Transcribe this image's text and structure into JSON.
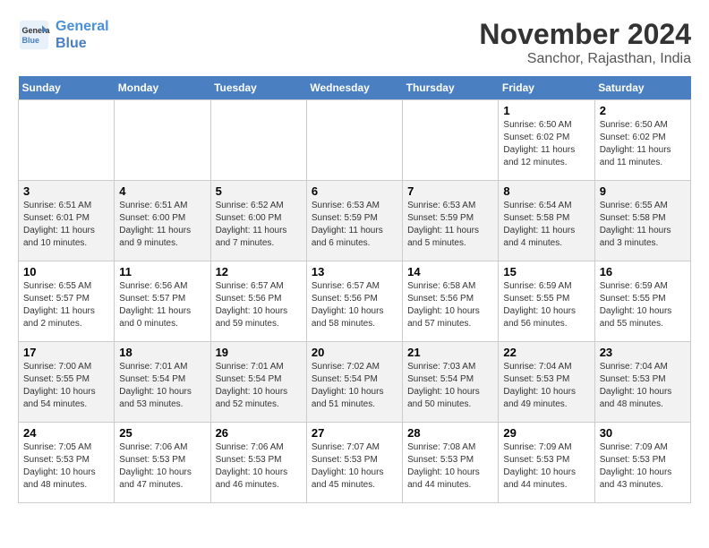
{
  "header": {
    "logo_line1": "General",
    "logo_line2": "Blue",
    "month": "November 2024",
    "location": "Sanchor, Rajasthan, India"
  },
  "weekdays": [
    "Sunday",
    "Monday",
    "Tuesday",
    "Wednesday",
    "Thursday",
    "Friday",
    "Saturday"
  ],
  "weeks": [
    [
      {
        "day": "",
        "info": ""
      },
      {
        "day": "",
        "info": ""
      },
      {
        "day": "",
        "info": ""
      },
      {
        "day": "",
        "info": ""
      },
      {
        "day": "",
        "info": ""
      },
      {
        "day": "1",
        "info": "Sunrise: 6:50 AM\nSunset: 6:02 PM\nDaylight: 11 hours and 12 minutes."
      },
      {
        "day": "2",
        "info": "Sunrise: 6:50 AM\nSunset: 6:02 PM\nDaylight: 11 hours and 11 minutes."
      }
    ],
    [
      {
        "day": "3",
        "info": "Sunrise: 6:51 AM\nSunset: 6:01 PM\nDaylight: 11 hours and 10 minutes."
      },
      {
        "day": "4",
        "info": "Sunrise: 6:51 AM\nSunset: 6:00 PM\nDaylight: 11 hours and 9 minutes."
      },
      {
        "day": "5",
        "info": "Sunrise: 6:52 AM\nSunset: 6:00 PM\nDaylight: 11 hours and 7 minutes."
      },
      {
        "day": "6",
        "info": "Sunrise: 6:53 AM\nSunset: 5:59 PM\nDaylight: 11 hours and 6 minutes."
      },
      {
        "day": "7",
        "info": "Sunrise: 6:53 AM\nSunset: 5:59 PM\nDaylight: 11 hours and 5 minutes."
      },
      {
        "day": "8",
        "info": "Sunrise: 6:54 AM\nSunset: 5:58 PM\nDaylight: 11 hours and 4 minutes."
      },
      {
        "day": "9",
        "info": "Sunrise: 6:55 AM\nSunset: 5:58 PM\nDaylight: 11 hours and 3 minutes."
      }
    ],
    [
      {
        "day": "10",
        "info": "Sunrise: 6:55 AM\nSunset: 5:57 PM\nDaylight: 11 hours and 2 minutes."
      },
      {
        "day": "11",
        "info": "Sunrise: 6:56 AM\nSunset: 5:57 PM\nDaylight: 11 hours and 0 minutes."
      },
      {
        "day": "12",
        "info": "Sunrise: 6:57 AM\nSunset: 5:56 PM\nDaylight: 10 hours and 59 minutes."
      },
      {
        "day": "13",
        "info": "Sunrise: 6:57 AM\nSunset: 5:56 PM\nDaylight: 10 hours and 58 minutes."
      },
      {
        "day": "14",
        "info": "Sunrise: 6:58 AM\nSunset: 5:56 PM\nDaylight: 10 hours and 57 minutes."
      },
      {
        "day": "15",
        "info": "Sunrise: 6:59 AM\nSunset: 5:55 PM\nDaylight: 10 hours and 56 minutes."
      },
      {
        "day": "16",
        "info": "Sunrise: 6:59 AM\nSunset: 5:55 PM\nDaylight: 10 hours and 55 minutes."
      }
    ],
    [
      {
        "day": "17",
        "info": "Sunrise: 7:00 AM\nSunset: 5:55 PM\nDaylight: 10 hours and 54 minutes."
      },
      {
        "day": "18",
        "info": "Sunrise: 7:01 AM\nSunset: 5:54 PM\nDaylight: 10 hours and 53 minutes."
      },
      {
        "day": "19",
        "info": "Sunrise: 7:01 AM\nSunset: 5:54 PM\nDaylight: 10 hours and 52 minutes."
      },
      {
        "day": "20",
        "info": "Sunrise: 7:02 AM\nSunset: 5:54 PM\nDaylight: 10 hours and 51 minutes."
      },
      {
        "day": "21",
        "info": "Sunrise: 7:03 AM\nSunset: 5:54 PM\nDaylight: 10 hours and 50 minutes."
      },
      {
        "day": "22",
        "info": "Sunrise: 7:04 AM\nSunset: 5:53 PM\nDaylight: 10 hours and 49 minutes."
      },
      {
        "day": "23",
        "info": "Sunrise: 7:04 AM\nSunset: 5:53 PM\nDaylight: 10 hours and 48 minutes."
      }
    ],
    [
      {
        "day": "24",
        "info": "Sunrise: 7:05 AM\nSunset: 5:53 PM\nDaylight: 10 hours and 48 minutes."
      },
      {
        "day": "25",
        "info": "Sunrise: 7:06 AM\nSunset: 5:53 PM\nDaylight: 10 hours and 47 minutes."
      },
      {
        "day": "26",
        "info": "Sunrise: 7:06 AM\nSunset: 5:53 PM\nDaylight: 10 hours and 46 minutes."
      },
      {
        "day": "27",
        "info": "Sunrise: 7:07 AM\nSunset: 5:53 PM\nDaylight: 10 hours and 45 minutes."
      },
      {
        "day": "28",
        "info": "Sunrise: 7:08 AM\nSunset: 5:53 PM\nDaylight: 10 hours and 44 minutes."
      },
      {
        "day": "29",
        "info": "Sunrise: 7:09 AM\nSunset: 5:53 PM\nDaylight: 10 hours and 44 minutes."
      },
      {
        "day": "30",
        "info": "Sunrise: 7:09 AM\nSunset: 5:53 PM\nDaylight: 10 hours and 43 minutes."
      }
    ]
  ]
}
